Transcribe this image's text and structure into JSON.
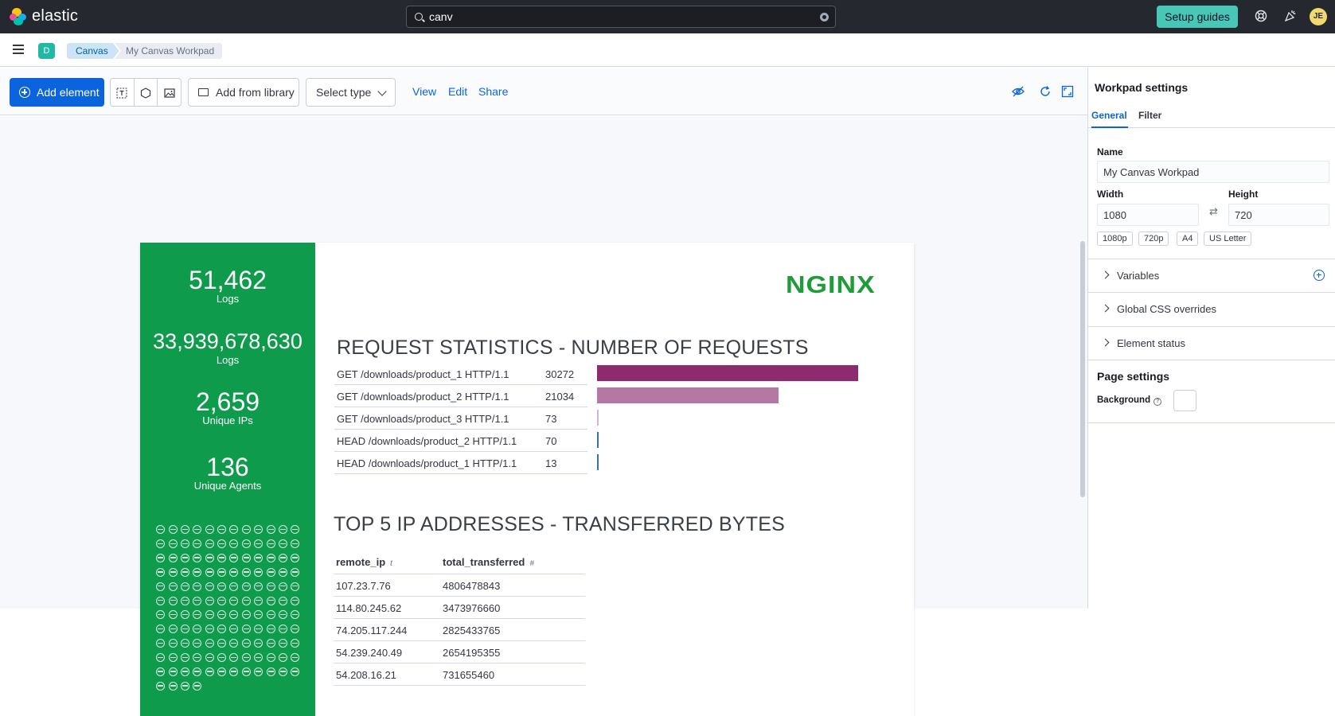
{
  "brand": {
    "name": "elastic"
  },
  "search": {
    "value": "canv"
  },
  "header": {
    "setup_label": "Setup guides",
    "avatar": "JE"
  },
  "nav": {
    "space": "D",
    "breadcrumbs": [
      "Canvas",
      "My Canvas Workpad"
    ]
  },
  "toolbar": {
    "add_element": "Add element",
    "add_from_library": "Add from library",
    "select_type": "Select type",
    "links": [
      "View",
      "Edit",
      "Share"
    ]
  },
  "workpad": {
    "metrics": [
      {
        "value": "51,462",
        "label": "Logs"
      },
      {
        "value": "33,939,678,630",
        "label": "Logs"
      },
      {
        "value": "2,659",
        "label": "Unique IPs"
      },
      {
        "value": "136",
        "label": "Unique Agents"
      }
    ],
    "logo": "NGINX",
    "request_title": "REQUEST STATISTICS - NUMBER OF REQUESTS",
    "requests": [
      {
        "path": "GET /downloads/product_1 HTTP/1.1",
        "count": "30272",
        "value": 30272,
        "color": "#8d2b6e"
      },
      {
        "path": "GET /downloads/product_2 HTTP/1.1",
        "count": "21034",
        "value": 21034,
        "color": "#b578a5"
      },
      {
        "path": "GET /downloads/product_3 HTTP/1.1",
        "count": "73",
        "value": 73,
        "color": "#d6b6cd"
      },
      {
        "path": "HEAD /downloads/product_2 HTTP/1.1",
        "count": "70",
        "value": 70,
        "color": "#3c6ea8"
      },
      {
        "path": "HEAD /downloads/product_1 HTTP/1.1",
        "count": "13",
        "value": 13,
        "color": "#3c6ea8"
      }
    ],
    "ip_title": "TOP 5 IP ADDRESSES - TRANSFERRED BYTES",
    "ip_columns": [
      "remote_ip",
      "total_transferred"
    ],
    "ip_column_types": [
      "t",
      "#"
    ],
    "ip_rows": [
      [
        "107.23.7.76",
        "4806478843"
      ],
      [
        "114.80.245.62",
        "3473976660"
      ],
      [
        "74.205.117.244",
        "2825433765"
      ],
      [
        "54.239.240.49",
        "2654195355"
      ],
      [
        "54.208.16.21",
        "731655460"
      ]
    ]
  },
  "sidebar": {
    "title": "Workpad settings",
    "tabs": [
      "General",
      "Filter"
    ],
    "name_label": "Name",
    "name_value": "My Canvas Workpad",
    "width_label": "Width",
    "width_value": "1080",
    "height_label": "Height",
    "height_value": "720",
    "presets": [
      "1080p",
      "720p",
      "A4",
      "US Letter"
    ],
    "sections": [
      "Variables",
      "Global CSS overrides",
      "Element status"
    ],
    "page_settings": "Page settings",
    "background_label": "Background",
    "background_color": "#ffffff"
  }
}
